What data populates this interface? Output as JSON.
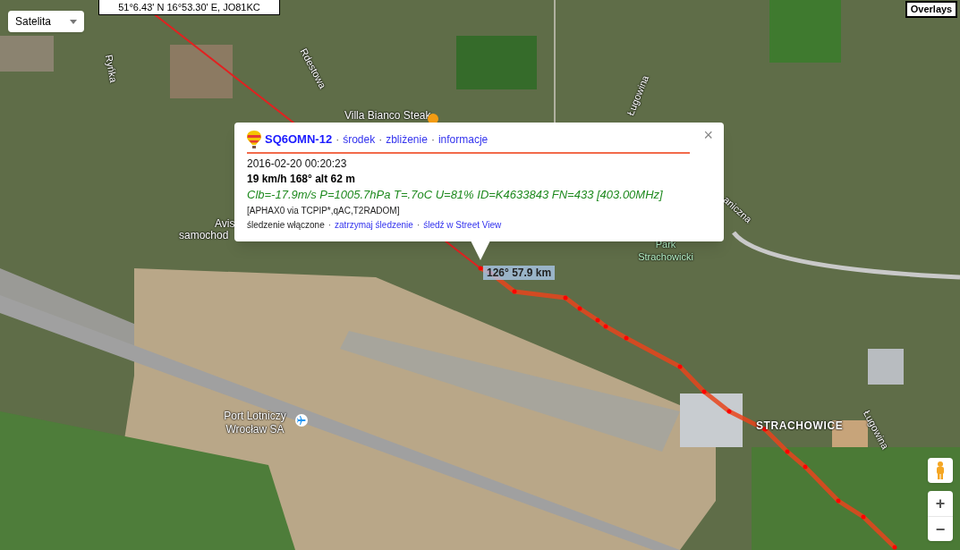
{
  "map_type_control": {
    "label": "Satelita"
  },
  "coordinates": "51°6.43' N 16°53.30' E, JO81KC",
  "overlays_button": "Overlays",
  "map_labels": [
    {
      "text": "Rdestowa",
      "kind": "street"
    },
    {
      "text": "Ryńka",
      "kind": "street"
    },
    {
      "text": "Villa Bianco Steak",
      "kind": "place"
    },
    {
      "text": "Ługowina",
      "kind": "street"
    },
    {
      "text": "Avis",
      "kind": "place"
    },
    {
      "text": "samochod",
      "kind": "place"
    },
    {
      "text": "aniczna",
      "kind": "street"
    },
    {
      "text": "Park Strachowicki",
      "kind": "park"
    },
    {
      "text": "Port Lotniczy Wrocław SA",
      "kind": "place"
    },
    {
      "text": "STRACHOWICE",
      "kind": "district"
    },
    {
      "text": "Ługowina",
      "kind": "street"
    }
  ],
  "popup": {
    "callsign": "SQ6OMN-12",
    "separator": "·",
    "links": [
      "środek",
      "zbliżenie",
      "informacje"
    ],
    "close": "×",
    "time": "2016-02-20 00:20:23",
    "motion": "19 km/h 168° alt 62 m",
    "comment": "Clb=-17.9m/s P=1005.7hPa T=.7oC U=81% ID=K4633843 FN=433 [403.00MHz]",
    "path": "[APHAX0 via TCPIP*,qAC,T2RADOM]",
    "tracking_status": "śledzenie włączone",
    "tracking_links": [
      "zatrzymaj śledzenie",
      "śledź w Street View"
    ]
  },
  "distance_label": "126° 57.9 km",
  "zoom_controls": [
    "+",
    "−"
  ]
}
